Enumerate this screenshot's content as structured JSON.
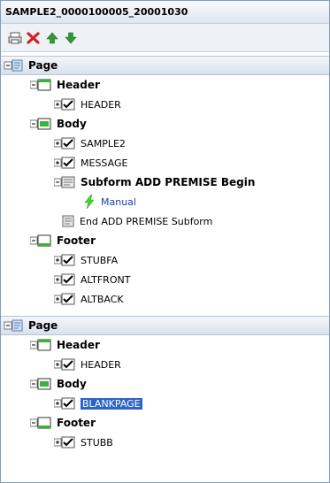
{
  "window": {
    "title": "SAMPLE2_0000100005_20001030"
  },
  "toolbar": {
    "buttons": [
      {
        "name": "print-icon"
      },
      {
        "name": "delete-icon",
        "color": "#d61f1f"
      },
      {
        "name": "move-up-icon",
        "color": "#2d9b2d"
      },
      {
        "name": "move-down-icon",
        "color": "#2d9b2d"
      }
    ]
  },
  "tree": {
    "page1": {
      "label": "Page",
      "header": {
        "label": "Header",
        "items": [
          "HEADER"
        ]
      },
      "body": {
        "label": "Body",
        "items": [
          "SAMPLE2",
          "MESSAGE"
        ],
        "subform": {
          "label": "Subform ADD PREMISE Begin",
          "child": "Manual"
        },
        "subform_end": "End ADD PREMISE Subform"
      },
      "footer": {
        "label": "Footer",
        "items": [
          "STUBFA",
          "ALTFRONT",
          "ALTBACK"
        ]
      }
    },
    "page2": {
      "label": "Page",
      "header": {
        "label": "Header",
        "items": [
          "HEADER"
        ]
      },
      "body": {
        "label": "Body",
        "items": [
          "BLANKPAGE"
        ]
      },
      "footer": {
        "label": "Footer",
        "items": [
          "STUBB"
        ]
      }
    }
  },
  "colors": {
    "selection": "#2f63c7",
    "accent": "#1b3fa8",
    "check": "#000000"
  }
}
